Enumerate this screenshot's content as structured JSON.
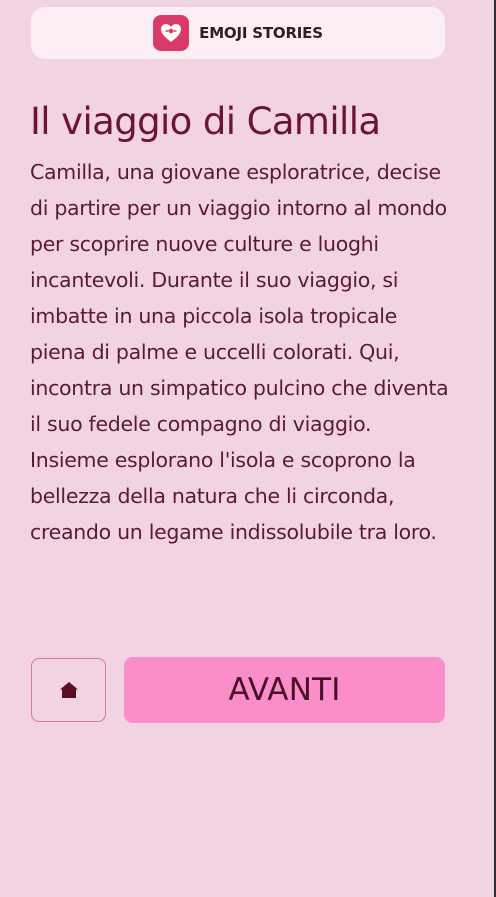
{
  "app": {
    "title": "EMOJI STORIES",
    "logo_icon": "puzzle-heart-icon",
    "logo_color": "#d93a6a"
  },
  "story": {
    "title": "Il viaggio di Camilla",
    "text": "Camilla, una giovane esploratrice, decise di partire per un viaggio intorno al mondo per scoprire nuove culture e luoghi incantevoli. Durante il suo viaggio, si imbatte in una piccola isola tropicale piena di palme e uccelli colorati. Qui, incontra un simpatico pulcino che diventa il suo fedele compagno di viaggio. Insieme esplorano l'isola e scoprono la bellezza della natura che li circonda, creando un legame indissolubile tra loro."
  },
  "actions": {
    "home_icon": "home-icon",
    "next_label": "AVANTI",
    "next_color": "#fb8dcb"
  },
  "colors": {
    "background": "#f2d3e2",
    "title": "#6b1532",
    "text": "#5a1a30"
  }
}
